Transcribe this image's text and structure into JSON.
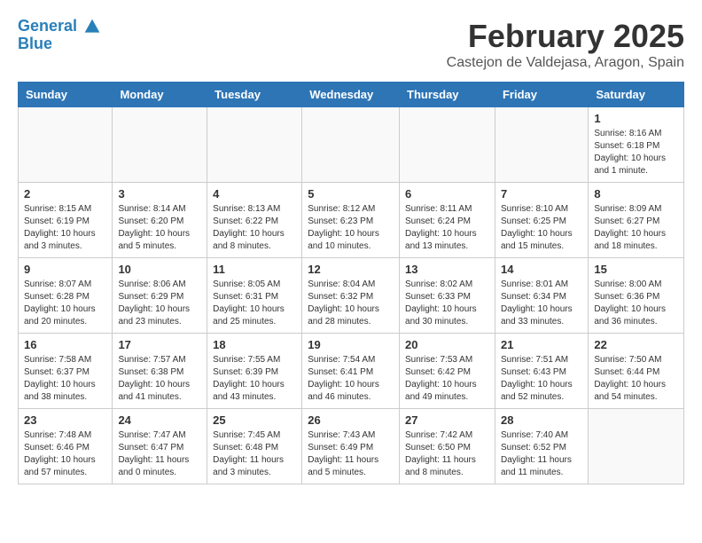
{
  "logo": {
    "line1": "General",
    "line2": "Blue"
  },
  "title": "February 2025",
  "subtitle": "Castejon de Valdejasa, Aragon, Spain",
  "days_of_week": [
    "Sunday",
    "Monday",
    "Tuesday",
    "Wednesday",
    "Thursday",
    "Friday",
    "Saturday"
  ],
  "weeks": [
    [
      {
        "day": "",
        "info": ""
      },
      {
        "day": "",
        "info": ""
      },
      {
        "day": "",
        "info": ""
      },
      {
        "day": "",
        "info": ""
      },
      {
        "day": "",
        "info": ""
      },
      {
        "day": "",
        "info": ""
      },
      {
        "day": "1",
        "info": "Sunrise: 8:16 AM\nSunset: 6:18 PM\nDaylight: 10 hours and 1 minute."
      }
    ],
    [
      {
        "day": "2",
        "info": "Sunrise: 8:15 AM\nSunset: 6:19 PM\nDaylight: 10 hours and 3 minutes."
      },
      {
        "day": "3",
        "info": "Sunrise: 8:14 AM\nSunset: 6:20 PM\nDaylight: 10 hours and 5 minutes."
      },
      {
        "day": "4",
        "info": "Sunrise: 8:13 AM\nSunset: 6:22 PM\nDaylight: 10 hours and 8 minutes."
      },
      {
        "day": "5",
        "info": "Sunrise: 8:12 AM\nSunset: 6:23 PM\nDaylight: 10 hours and 10 minutes."
      },
      {
        "day": "6",
        "info": "Sunrise: 8:11 AM\nSunset: 6:24 PM\nDaylight: 10 hours and 13 minutes."
      },
      {
        "day": "7",
        "info": "Sunrise: 8:10 AM\nSunset: 6:25 PM\nDaylight: 10 hours and 15 minutes."
      },
      {
        "day": "8",
        "info": "Sunrise: 8:09 AM\nSunset: 6:27 PM\nDaylight: 10 hours and 18 minutes."
      }
    ],
    [
      {
        "day": "9",
        "info": "Sunrise: 8:07 AM\nSunset: 6:28 PM\nDaylight: 10 hours and 20 minutes."
      },
      {
        "day": "10",
        "info": "Sunrise: 8:06 AM\nSunset: 6:29 PM\nDaylight: 10 hours and 23 minutes."
      },
      {
        "day": "11",
        "info": "Sunrise: 8:05 AM\nSunset: 6:31 PM\nDaylight: 10 hours and 25 minutes."
      },
      {
        "day": "12",
        "info": "Sunrise: 8:04 AM\nSunset: 6:32 PM\nDaylight: 10 hours and 28 minutes."
      },
      {
        "day": "13",
        "info": "Sunrise: 8:02 AM\nSunset: 6:33 PM\nDaylight: 10 hours and 30 minutes."
      },
      {
        "day": "14",
        "info": "Sunrise: 8:01 AM\nSunset: 6:34 PM\nDaylight: 10 hours and 33 minutes."
      },
      {
        "day": "15",
        "info": "Sunrise: 8:00 AM\nSunset: 6:36 PM\nDaylight: 10 hours and 36 minutes."
      }
    ],
    [
      {
        "day": "16",
        "info": "Sunrise: 7:58 AM\nSunset: 6:37 PM\nDaylight: 10 hours and 38 minutes."
      },
      {
        "day": "17",
        "info": "Sunrise: 7:57 AM\nSunset: 6:38 PM\nDaylight: 10 hours and 41 minutes."
      },
      {
        "day": "18",
        "info": "Sunrise: 7:55 AM\nSunset: 6:39 PM\nDaylight: 10 hours and 43 minutes."
      },
      {
        "day": "19",
        "info": "Sunrise: 7:54 AM\nSunset: 6:41 PM\nDaylight: 10 hours and 46 minutes."
      },
      {
        "day": "20",
        "info": "Sunrise: 7:53 AM\nSunset: 6:42 PM\nDaylight: 10 hours and 49 minutes."
      },
      {
        "day": "21",
        "info": "Sunrise: 7:51 AM\nSunset: 6:43 PM\nDaylight: 10 hours and 52 minutes."
      },
      {
        "day": "22",
        "info": "Sunrise: 7:50 AM\nSunset: 6:44 PM\nDaylight: 10 hours and 54 minutes."
      }
    ],
    [
      {
        "day": "23",
        "info": "Sunrise: 7:48 AM\nSunset: 6:46 PM\nDaylight: 10 hours and 57 minutes."
      },
      {
        "day": "24",
        "info": "Sunrise: 7:47 AM\nSunset: 6:47 PM\nDaylight: 11 hours and 0 minutes."
      },
      {
        "day": "25",
        "info": "Sunrise: 7:45 AM\nSunset: 6:48 PM\nDaylight: 11 hours and 3 minutes."
      },
      {
        "day": "26",
        "info": "Sunrise: 7:43 AM\nSunset: 6:49 PM\nDaylight: 11 hours and 5 minutes."
      },
      {
        "day": "27",
        "info": "Sunrise: 7:42 AM\nSunset: 6:50 PM\nDaylight: 11 hours and 8 minutes."
      },
      {
        "day": "28",
        "info": "Sunrise: 7:40 AM\nSunset: 6:52 PM\nDaylight: 11 hours and 11 minutes."
      },
      {
        "day": "",
        "info": ""
      }
    ]
  ]
}
